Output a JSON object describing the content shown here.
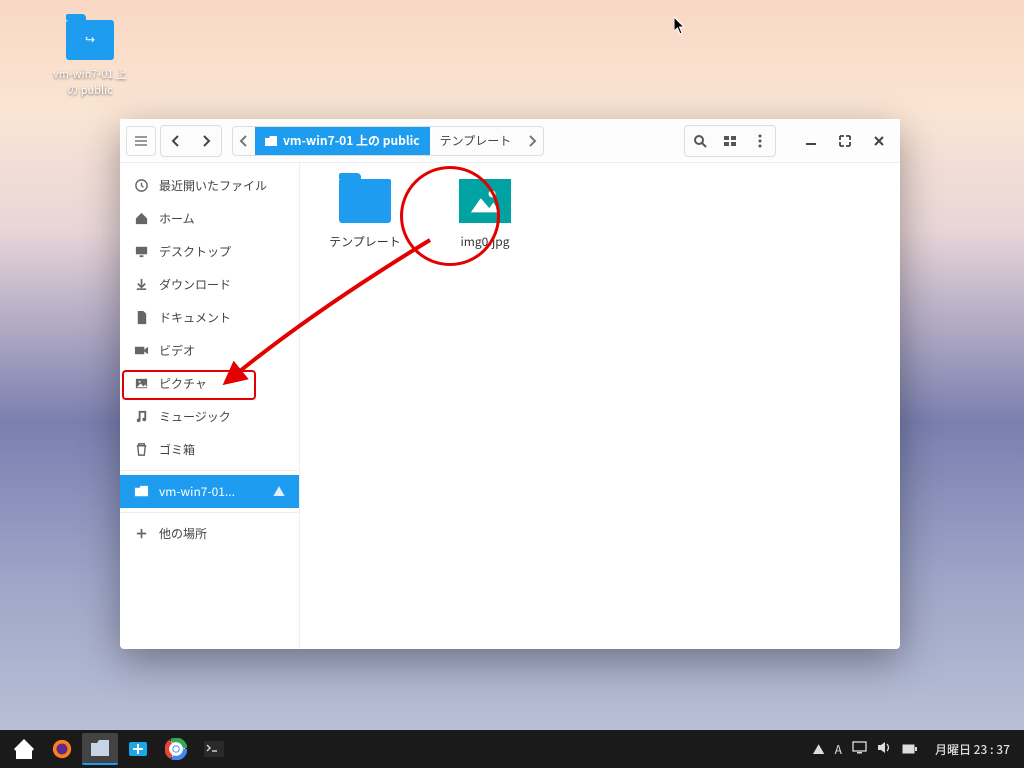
{
  "desktop_icon_label": "vm-win7-01 上の public",
  "pathbar": {
    "seg1": "vm-win7-01 上の public",
    "seg2": "テンプレート"
  },
  "sidebar": {
    "recent": "最近開いたファイル",
    "home": "ホーム",
    "desktop": "デスクトップ",
    "downloads": "ダウンロード",
    "documents": "ドキュメント",
    "videos": "ビデオ",
    "pictures": "ピクチャ",
    "music": "ミュージック",
    "trash": "ゴミ箱",
    "network": "vm-win7-01...",
    "other": "他の場所"
  },
  "files": {
    "templates": "テンプレート",
    "image": "img0.jpg"
  },
  "clock": "月曜日 23 : 37",
  "tray": {
    "lang": "A"
  }
}
